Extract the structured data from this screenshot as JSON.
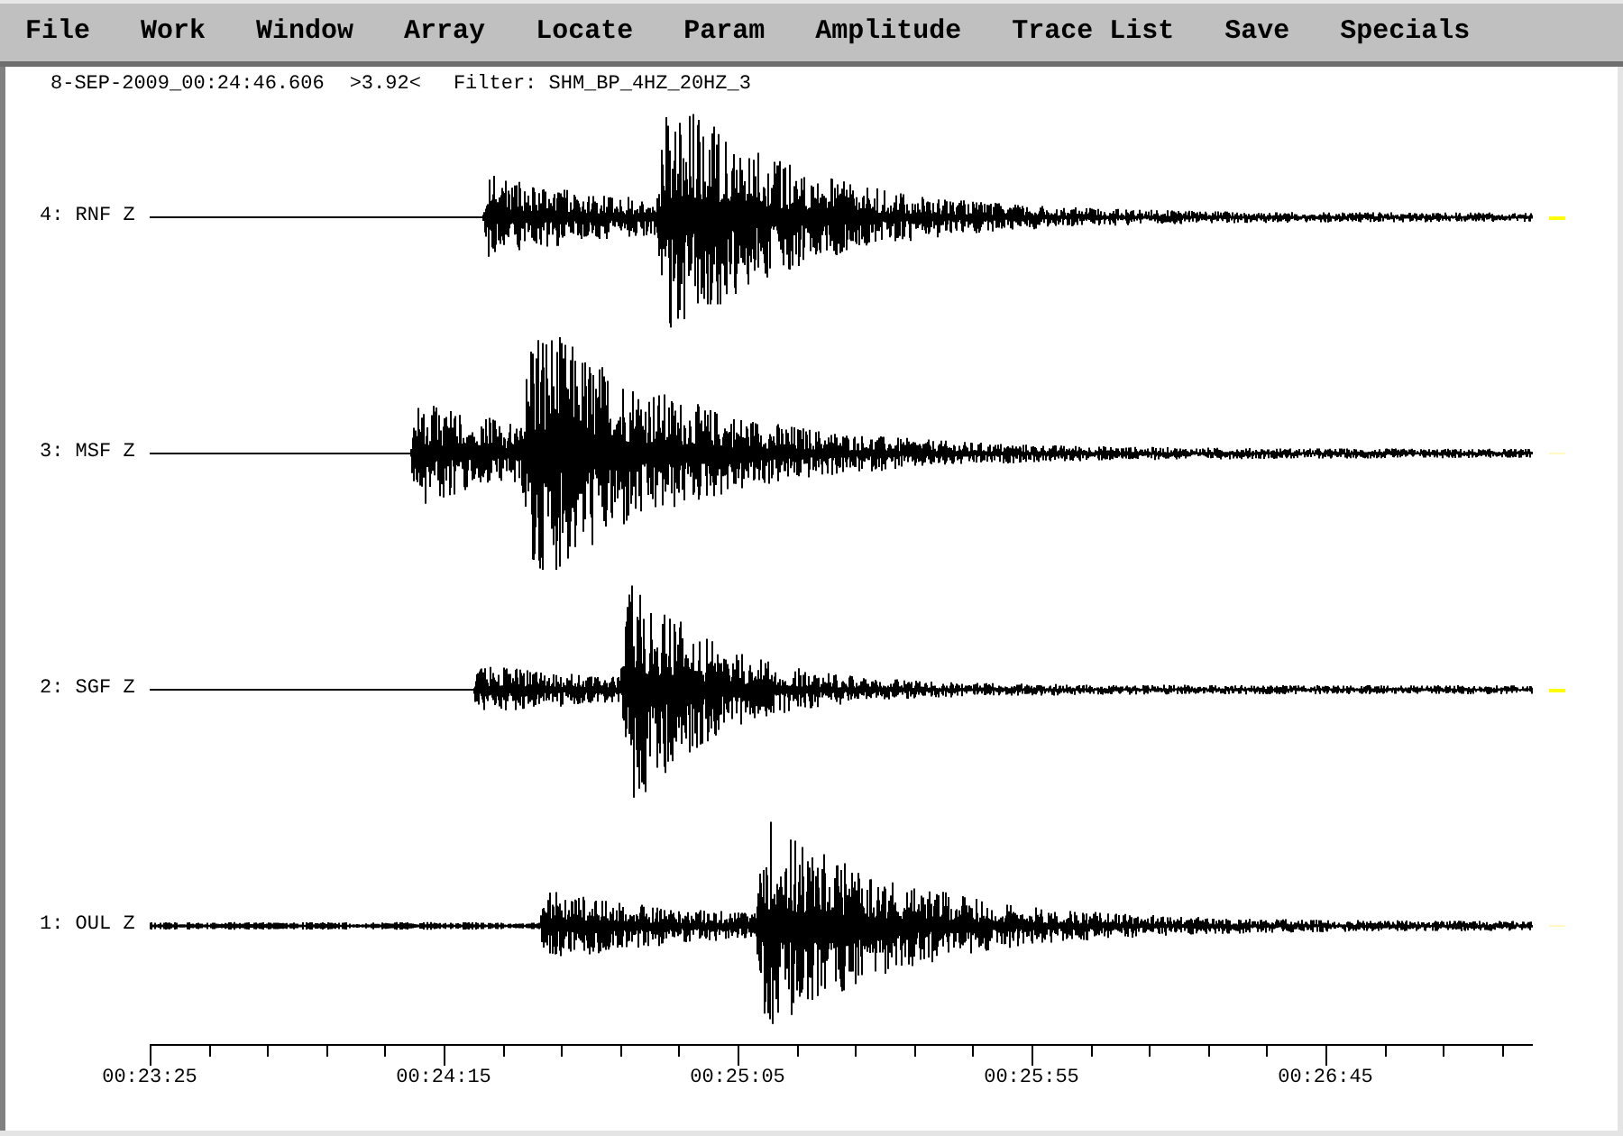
{
  "menu": [
    "File",
    "Work",
    "Window",
    "Array",
    "Locate",
    "Param",
    "Amplitude",
    "Trace List",
    "Save",
    "Specials"
  ],
  "header": {
    "timestamp": "8-SEP-2009_00:24:46.606",
    "scale": ">3.92<",
    "filter": "Filter: SHM_BP_4HZ_20HZ_3"
  },
  "traces": [
    {
      "label": "4: RNF Z",
      "selected": true
    },
    {
      "label": "3: MSF Z",
      "selected": false
    },
    {
      "label": "2: SGF Z",
      "selected": true
    },
    {
      "label": "1: OUL Z",
      "selected": false
    }
  ],
  "time_axis": {
    "labels": [
      "00:23:25",
      "00:24:15",
      "00:25:05",
      "00:25:55",
      "00:26:45"
    ]
  }
}
